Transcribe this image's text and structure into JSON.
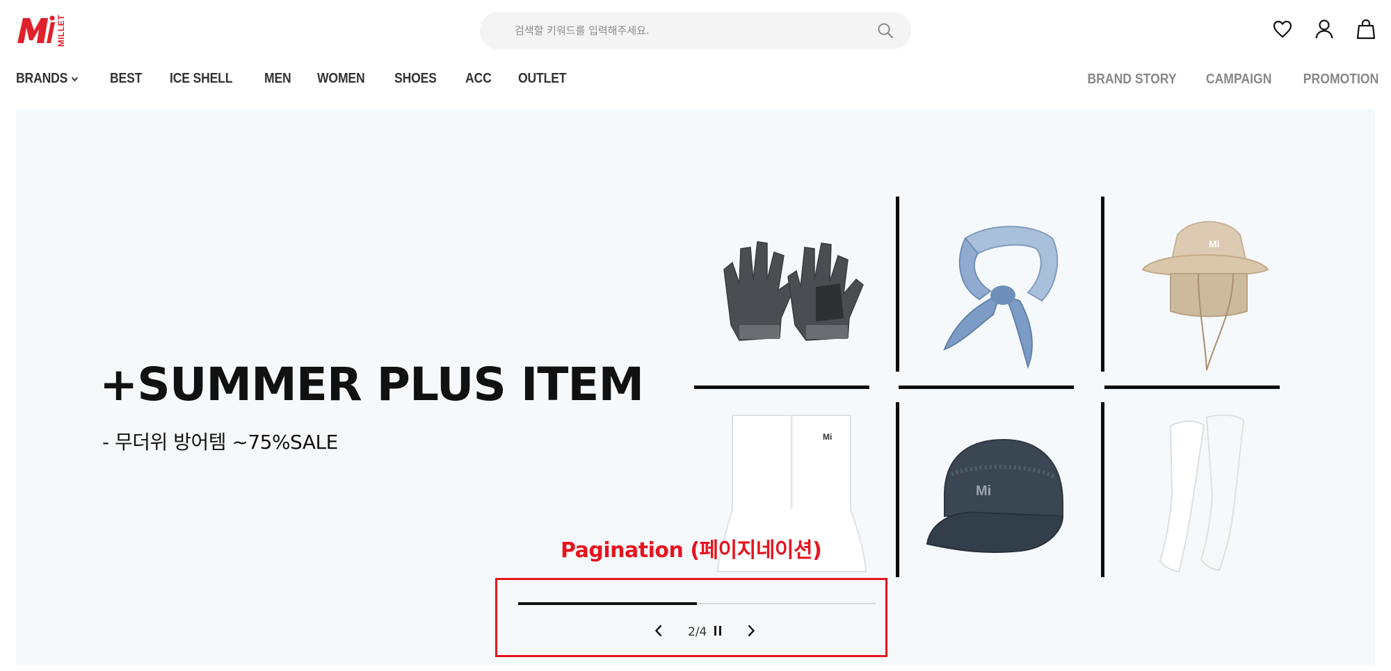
{
  "header": {
    "logo_text": "MILLET",
    "search": {
      "placeholder": "검색할 키워드를 입력해주세요."
    },
    "utility_icons": [
      "heart-icon",
      "user-icon",
      "shopping-bag-icon"
    ]
  },
  "nav": {
    "main": [
      {
        "label": "BRANDS",
        "has_dropdown": true
      },
      {
        "label": "BEST"
      },
      {
        "label": "ICE SHELL"
      },
      {
        "label": "MEN"
      },
      {
        "label": "WOMEN"
      },
      {
        "label": "SHOES"
      },
      {
        "label": "ACC"
      },
      {
        "label": "OUTLET"
      }
    ],
    "secondary": [
      {
        "label": "BRAND STORY"
      },
      {
        "label": "CAMPAIGN"
      },
      {
        "label": "PROMOTION"
      }
    ]
  },
  "banner": {
    "headline": "+SUMMER PLUS ITEM",
    "subline": "- 무더위 방어템 ~75%SALE",
    "products": [
      "gloves",
      "scarf",
      "sun-hat",
      "neck-gaiter",
      "cap",
      "arm-sleeves"
    ]
  },
  "annotation": {
    "label": "Pagination (페이지네이션)",
    "color": "#e6141e"
  },
  "pagination": {
    "current": 2,
    "total": 4,
    "text": "2/4",
    "progress": 0.5
  },
  "colors": {
    "brand_red": "#e1202b",
    "banner_bg": "#f6f9fc"
  }
}
